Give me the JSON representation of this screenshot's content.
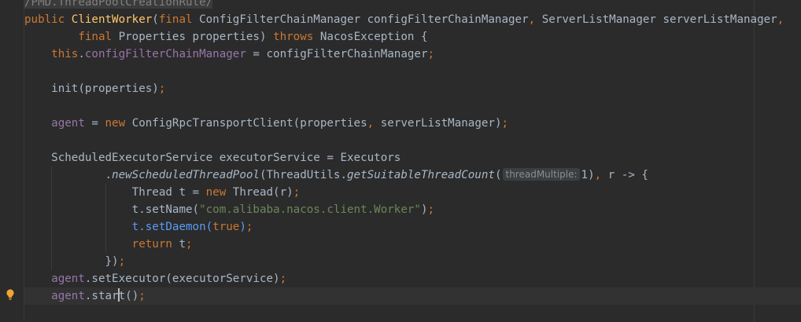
{
  "editor": {
    "lines": [
      {
        "tokens": [
          {
            "t": "/PMD.ThreadPoolCreationRule/",
            "c": "comment-hl"
          }
        ]
      },
      {
        "tokens": [
          {
            "t": "public ",
            "c": "kw"
          },
          {
            "t": "ClientWorker",
            "c": "fn"
          },
          {
            "t": "(",
            "c": ""
          },
          {
            "t": "final ",
            "c": "kw"
          },
          {
            "t": "ConfigFilterChainManager configFilterChainManager",
            "c": ""
          },
          {
            "t": ", ",
            "c": "kw"
          },
          {
            "t": "ServerListManager serverListManager",
            "c": ""
          },
          {
            "t": ",",
            "c": "kw"
          }
        ]
      },
      {
        "tokens": [
          {
            "t": "        ",
            "c": ""
          },
          {
            "t": "final ",
            "c": "kw"
          },
          {
            "t": "Properties properties) ",
            "c": ""
          },
          {
            "t": "throws ",
            "c": "kw"
          },
          {
            "t": "NacosException {",
            "c": ""
          }
        ]
      },
      {
        "tokens": [
          {
            "t": "    ",
            "c": ""
          },
          {
            "t": "this",
            "c": "kw"
          },
          {
            "t": ".",
            "c": ""
          },
          {
            "t": "configFilterChainManager",
            "c": "field"
          },
          {
            "t": " = configFilterChainManager",
            "c": ""
          },
          {
            "t": ";",
            "c": "kw"
          }
        ]
      },
      {
        "tokens": []
      },
      {
        "tokens": [
          {
            "t": "    init(properties)",
            "c": ""
          },
          {
            "t": ";",
            "c": "kw"
          }
        ]
      },
      {
        "tokens": []
      },
      {
        "tokens": [
          {
            "t": "    ",
            "c": ""
          },
          {
            "t": "agent",
            "c": "field"
          },
          {
            "t": " = ",
            "c": ""
          },
          {
            "t": "new ",
            "c": "kw"
          },
          {
            "t": "ConfigRpcTransportClient(properties",
            "c": ""
          },
          {
            "t": ", ",
            "c": "kw"
          },
          {
            "t": "serverListManager)",
            "c": ""
          },
          {
            "t": ";",
            "c": "kw"
          }
        ]
      },
      {
        "tokens": []
      },
      {
        "tokens": [
          {
            "t": "    ScheduledExecutorService executorService = Executors",
            "c": ""
          }
        ]
      },
      {
        "tokens": [
          {
            "t": "            .",
            "c": ""
          },
          {
            "t": "newScheduledThreadPool",
            "c": "italic"
          },
          {
            "t": "(ThreadUtils.",
            "c": ""
          },
          {
            "t": "getSuitableThreadCount",
            "c": "italic"
          },
          {
            "t": "(",
            "c": ""
          },
          {
            "hint": "threadMultiple:"
          },
          {
            "t": "1)",
            "c": ""
          },
          {
            "t": ", ",
            "c": "kw"
          },
          {
            "t": "r -> {",
            "c": ""
          }
        ]
      },
      {
        "tokens": [
          {
            "t": "                Thread t = ",
            "c": ""
          },
          {
            "t": "new ",
            "c": "kw"
          },
          {
            "t": "Thread(r)",
            "c": ""
          },
          {
            "t": ";",
            "c": "kw"
          }
        ]
      },
      {
        "tokens": [
          {
            "t": "                t.setName(",
            "c": ""
          },
          {
            "t": "\"com.alibaba.nacos.client.Worker\"",
            "c": "str"
          },
          {
            "t": ")",
            "c": ""
          },
          {
            "t": ";",
            "c": "kw"
          }
        ]
      },
      {
        "tokens": [
          {
            "t": "                ",
            "c": ""
          },
          {
            "t": "t.setDaemon(",
            "c": "sel-hl"
          },
          {
            "t": "true",
            "c": "kw"
          },
          {
            "t": ")",
            "c": "sel-hl"
          },
          {
            "t": ";",
            "c": "kw"
          }
        ]
      },
      {
        "tokens": [
          {
            "t": "                ",
            "c": ""
          },
          {
            "t": "return ",
            "c": "kw"
          },
          {
            "t": "t",
            "c": ""
          },
          {
            "t": ";",
            "c": "kw"
          }
        ]
      },
      {
        "tokens": [
          {
            "t": "            })",
            "c": ""
          },
          {
            "t": ";",
            "c": "kw"
          }
        ]
      },
      {
        "tokens": [
          {
            "t": "    ",
            "c": ""
          },
          {
            "t": "agent",
            "c": "field"
          },
          {
            "t": ".setExecutor(executorService)",
            "c": ""
          },
          {
            "t": ";",
            "c": "kw"
          }
        ]
      },
      {
        "tokens": [
          {
            "t": "    ",
            "c": ""
          },
          {
            "t": "agent",
            "c": "field"
          },
          {
            "t": ".star",
            "c": ""
          },
          {
            "caret": true
          },
          {
            "t": "t()",
            "c": ""
          },
          {
            "t": ";",
            "c": "kw"
          }
        ],
        "current": true
      },
      {
        "tokens": []
      }
    ]
  },
  "gutter": {
    "intention_icon": "lightbulb-icon",
    "intention_color": "#f0a732"
  }
}
